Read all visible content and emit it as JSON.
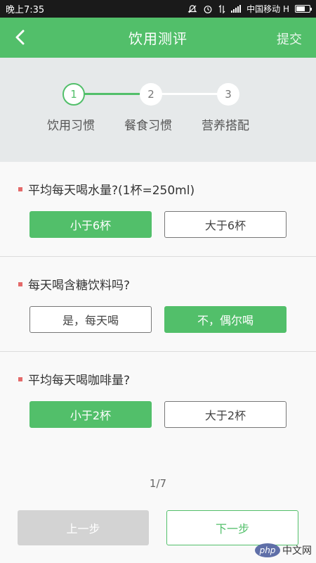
{
  "status_bar": {
    "time": "晚上7:35",
    "carrier": "中国移动 H"
  },
  "header": {
    "title": "饮用测评",
    "submit_label": "提交"
  },
  "steps": [
    {
      "number": "1",
      "label": "饮用习惯",
      "active": true
    },
    {
      "number": "2",
      "label": "餐食习惯",
      "active": false
    },
    {
      "number": "3",
      "label": "营养搭配",
      "active": false
    }
  ],
  "questions": [
    {
      "text": "平均每天喝水量?(1杯=250ml)",
      "options": [
        {
          "label": "小于6杯",
          "selected": true
        },
        {
          "label": "大于6杯",
          "selected": false
        }
      ]
    },
    {
      "text": "每天喝含糖饮料吗?",
      "options": [
        {
          "label": "是，每天喝",
          "selected": false
        },
        {
          "label": "不，偶尔喝",
          "selected": true
        }
      ]
    },
    {
      "text": "平均每天喝咖啡量?",
      "options": [
        {
          "label": "小于2杯",
          "selected": true
        },
        {
          "label": "大于2杯",
          "selected": false
        }
      ]
    }
  ],
  "page_indicator": "1/7",
  "buttons": {
    "prev_label": "上一步",
    "next_label": "下一步"
  },
  "watermark": {
    "badge": "php",
    "text": "中文网"
  },
  "colors": {
    "accent": "#52bf6a",
    "bullet": "#e46a6a",
    "disabled": "#d3d3d3"
  }
}
